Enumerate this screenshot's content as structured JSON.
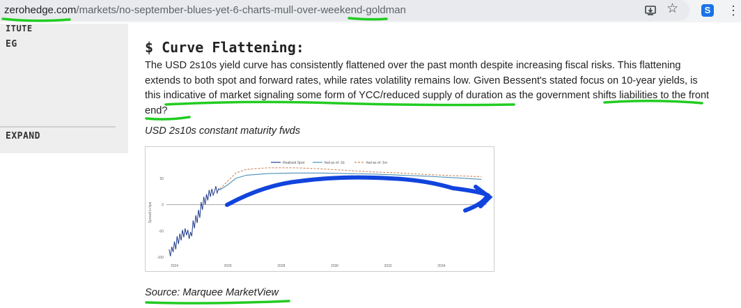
{
  "browser": {
    "url_domain": "zerohedge.com",
    "url_path": "/markets/no-september-blues-yet-6-charts-mull-over-weekend-goldman",
    "install_icon": "install-app-icon",
    "bookmark_icon": "star-icon",
    "extension_label": "S",
    "menu_icon": "vertical-dots-icon"
  },
  "sidebar": {
    "partial_top": "ITUTE",
    "item": "EG",
    "expand_label": "EXPAND"
  },
  "article": {
    "heading": "$ Curve Flattening:",
    "para_1": "The USD 2s10s yield curve has consistently flattened over the past month despite increasing fiscal risks. This flattening extends to both spot and forward rates, while rates volatility remains low. Given Bessent's stated focus on 10-year yields, is this ",
    "link_1": "indicative of market signaling some form of YCC/reduced supply of duration",
    "para_2": " as the government ",
    "link_2": "shifts liabilities to the front end",
    "para_3": "?",
    "caption": "USD 2s10s constant maturity fwds",
    "source": "Source: Marquee MarketView"
  },
  "chart_data": {
    "type": "line",
    "title": "",
    "xlabel": "",
    "ylabel": "Spread in bps",
    "x_ticks": [
      "2024",
      "2026",
      "2028",
      "2030",
      "2032",
      "2034"
    ],
    "y_ticks": [
      50,
      0,
      -50,
      -100
    ],
    "xlim": [
      2023.7,
      2035.7
    ],
    "ylim": [
      -105,
      75
    ],
    "legend_position": "top-center",
    "series": [
      {
        "name": "Realised Spot",
        "color": "#1f3a8a",
        "dash": "solid",
        "points": [
          [
            2023.8,
            -85
          ],
          [
            2023.85,
            -98
          ],
          [
            2023.9,
            -80
          ],
          [
            2023.95,
            -90
          ],
          [
            2024.0,
            -70
          ],
          [
            2024.05,
            -85
          ],
          [
            2024.1,
            -60
          ],
          [
            2024.15,
            -75
          ],
          [
            2024.2,
            -55
          ],
          [
            2024.25,
            -68
          ],
          [
            2024.3,
            -48
          ],
          [
            2024.35,
            -62
          ],
          [
            2024.4,
            -45
          ],
          [
            2024.45,
            -58
          ],
          [
            2024.5,
            -48
          ],
          [
            2024.55,
            -65
          ],
          [
            2024.6,
            -52
          ],
          [
            2024.65,
            -60
          ],
          [
            2024.7,
            -30
          ],
          [
            2024.75,
            -45
          ],
          [
            2024.8,
            -20
          ],
          [
            2024.85,
            -35
          ],
          [
            2024.9,
            -10
          ],
          [
            2024.95,
            -25
          ],
          [
            2025.0,
            5
          ],
          [
            2025.05,
            -10
          ],
          [
            2025.1,
            15
          ],
          [
            2025.15,
            0
          ],
          [
            2025.2,
            20
          ],
          [
            2025.25,
            8
          ],
          [
            2025.3,
            28
          ],
          [
            2025.35,
            15
          ],
          [
            2025.4,
            30
          ],
          [
            2025.45,
            18
          ],
          [
            2025.5,
            25
          ],
          [
            2025.55,
            35
          ],
          [
            2025.6,
            22
          ],
          [
            2025.65,
            30
          ],
          [
            2025.7,
            28
          ]
        ]
      },
      {
        "name": "fwd as of -1b",
        "color": "#4a90b8",
        "dash": "solid",
        "points": [
          [
            2025.7,
            28
          ],
          [
            2026.0,
            38
          ],
          [
            2026.3,
            50
          ],
          [
            2026.7,
            56
          ],
          [
            2027.5,
            59
          ],
          [
            2028.5,
            60
          ],
          [
            2029.5,
            60
          ],
          [
            2030.5,
            59
          ],
          [
            2031.5,
            58
          ],
          [
            2032.5,
            56
          ],
          [
            2033.5,
            54
          ],
          [
            2034.5,
            51
          ],
          [
            2035.5,
            48
          ]
        ]
      },
      {
        "name": "fwd as of -1m",
        "color": "#c9885e",
        "dash": "dashed",
        "points": [
          [
            2025.7,
            30
          ],
          [
            2026.0,
            45
          ],
          [
            2026.3,
            60
          ],
          [
            2026.7,
            67
          ],
          [
            2027.5,
            70
          ],
          [
            2028.5,
            70
          ],
          [
            2029.5,
            68
          ],
          [
            2030.5,
            65
          ],
          [
            2031.5,
            62
          ],
          [
            2032.5,
            60
          ],
          [
            2033.5,
            57
          ],
          [
            2034.5,
            55
          ],
          [
            2035.5,
            53
          ]
        ]
      }
    ]
  },
  "annotations": {
    "color": "#22cc22",
    "arrow_color": "#1144dd"
  }
}
